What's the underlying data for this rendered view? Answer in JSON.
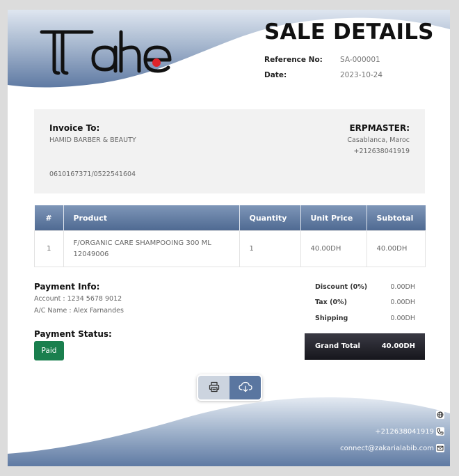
{
  "header": {
    "logo_text": "Tahe",
    "title": "SALE DETAILS",
    "reference_label": "Reference No:",
    "reference_value": "SA-000001",
    "date_label": "Date:",
    "date_value": "2023-10-24"
  },
  "invoice_to": {
    "label": "Invoice To:",
    "name": "HAMID BARBER & BEAUTY",
    "phone": "0610167371/0522541604"
  },
  "company": {
    "name": "ERPMASTER:",
    "city": "Casablanca, Maroc",
    "phone": "+212638041919"
  },
  "table": {
    "columns": [
      "#",
      "Product",
      "Quantity",
      "Unit Price",
      "Subtotal"
    ],
    "rows": [
      {
        "index": "1",
        "product_line1": "F/ORGANIC CARE SHAMPOOING 300 ML",
        "product_line2": "12049006",
        "quantity": "1",
        "unit_price": "40.00DH",
        "subtotal": "40.00DH"
      }
    ]
  },
  "payment_info": {
    "title": "Payment Info:",
    "account": "Account : 1234 5678 9012",
    "ac_name": "A/C Name : Alex Farnandes"
  },
  "payment_status": {
    "title": "Payment Status:",
    "badge": "Paid"
  },
  "summary": {
    "discount_label": "Discount (0%)",
    "discount_value": "0.00DH",
    "tax_label": "Tax (0%)",
    "tax_value": "0.00DH",
    "shipping_label": "Shipping",
    "shipping_value": "0.00DH",
    "grand_total_label": "Grand Total",
    "grand_total_value": "40.00DH"
  },
  "actions": {
    "print_icon": "printer-icon",
    "download_icon": "cloud-download-icon"
  },
  "footer": {
    "phone": "+212638041919",
    "email": "connect@zakarialabib.com",
    "icons": [
      "globe-icon",
      "phone-icon",
      "mail-icon"
    ]
  },
  "colors": {
    "wave_blue": "#5f7aa3",
    "paid_green": "#1a7f4e",
    "grand_total_bg": "#1d1d24",
    "logo_dot": "#e0242a"
  }
}
